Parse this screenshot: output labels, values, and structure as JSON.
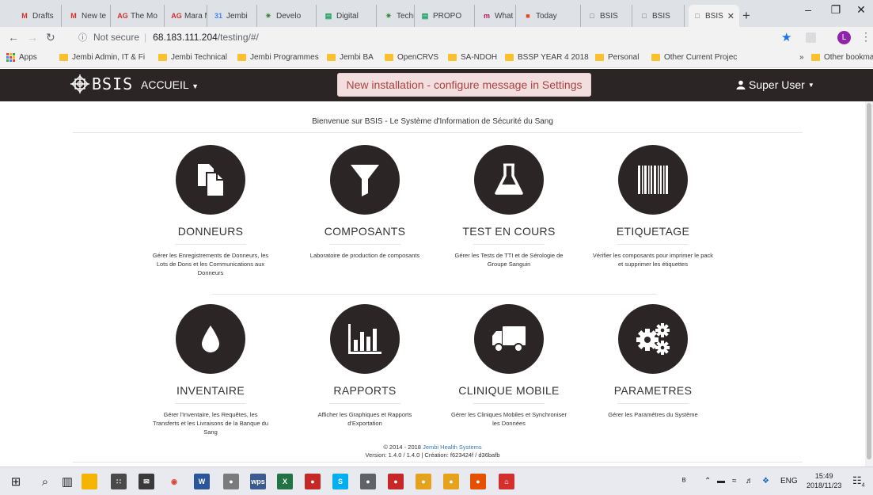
{
  "browser": {
    "tabs": [
      {
        "favicon": "M",
        "favcolor": "#d93025",
        "title": "Drafts",
        "active": false
      },
      {
        "favicon": "M",
        "favcolor": "#d93025",
        "title": "New te",
        "active": false
      },
      {
        "favicon": "AG",
        "favcolor": "#d32f2f",
        "title": "The Mo",
        "active": false
      },
      {
        "favicon": "AG",
        "favcolor": "#d32f2f",
        "title": "Mara M",
        "active": false
      },
      {
        "favicon": "31",
        "favcolor": "#4285f4",
        "title": "Jembi",
        "active": false
      },
      {
        "favicon": "✴",
        "favcolor": "#2e7d32",
        "title": "Develo",
        "active": false
      },
      {
        "favicon": "▤",
        "favcolor": "#0f9d58",
        "title": "Digital",
        "active": false
      },
      {
        "favicon": "✴",
        "favcolor": "#2e7d32",
        "title": "Technic",
        "active": false
      },
      {
        "favicon": "▤",
        "favcolor": "#0f9d58",
        "title": "PROPO",
        "active": false
      },
      {
        "favicon": "m",
        "favcolor": "#c2185b",
        "title": "What is",
        "active": false
      },
      {
        "favicon": "■",
        "favcolor": "#e64a19",
        "title": "Today",
        "active": false
      },
      {
        "favicon": "□",
        "favcolor": "#5f6368",
        "title": "BSIS",
        "active": false
      },
      {
        "favicon": "□",
        "favcolor": "#5f6368",
        "title": "BSIS",
        "active": false
      },
      {
        "favicon": "□",
        "favcolor": "#5f6368",
        "title": "BSIS",
        "active": true
      }
    ],
    "new_tab": "+",
    "window_controls": {
      "minimize": "–",
      "restore": "❐",
      "close": "✕"
    },
    "address": {
      "security_label": "Not secure",
      "host": "68.183.111.204",
      "path": "/testing/#/"
    },
    "profile_initial": "L",
    "bookmarks": [
      {
        "label": "Apps",
        "icon": "apps-grid"
      },
      {
        "label": "Jembi Admin, IT & Fi",
        "icon": "folder"
      },
      {
        "label": "Jembi Technical",
        "icon": "folder"
      },
      {
        "label": "Jembi Programmes",
        "icon": "folder"
      },
      {
        "label": "Jembi BA",
        "icon": "folder"
      },
      {
        "label": "OpenCRVS",
        "icon": "folder"
      },
      {
        "label": "SA-NDOH",
        "icon": "folder"
      },
      {
        "label": "BSSP YEAR 4 2018",
        "icon": "folder"
      },
      {
        "label": "Personal",
        "icon": "folder"
      },
      {
        "label": "Other Current Projec",
        "icon": "folder"
      }
    ],
    "bookmarks_overflow": "»",
    "other_bookmarks": "Other bookmarks"
  },
  "app": {
    "logo_text": "BSIS",
    "nav_menu": "ACCUEIL",
    "banner": "New installation - configure message in Settings",
    "user_menu": "Super User",
    "welcome": "Bienvenue sur BSIS - Le Système d'Information de Sécurité du Sang",
    "tiles": [
      {
        "title": "DONNEURS",
        "icon": "documents-icon",
        "description": "Gérer les Enregistrements de Donneurs, les Lots de Dons et les Communications aux Donneurs"
      },
      {
        "title": "COMPOSANTS",
        "icon": "filter-icon",
        "description": "Laboratoire de production de composants"
      },
      {
        "title": "TEST EN COURS",
        "icon": "flask-icon",
        "description": "Gérer les Tests de TTI et de Sérologie de Groupe Sanguin"
      },
      {
        "title": "ETIQUETAGE",
        "icon": "barcode-icon",
        "description": "Vérifier les composants pour imprimer le pack et supprimer les étiquettes"
      },
      {
        "title": "INVENTAIRE",
        "icon": "blood-drop-icon",
        "description": "Gérer l'Inventaire, les Requêtes, les Transferts et les Livraisons de la Banque du Sang"
      },
      {
        "title": "RAPPORTS",
        "icon": "bar-chart-icon",
        "description": "Afficher les Graphiques et Rapports d'Exportation"
      },
      {
        "title": "CLINIQUE MOBILE",
        "icon": "truck-icon",
        "description": "Gérer les Cliniques Mobiles et Synchroniser les Données"
      },
      {
        "title": "PARAMETRES",
        "icon": "gears-icon",
        "description": "Gérer les Paramètres du Système"
      }
    ],
    "footer": {
      "copyright": "© 2014 - 2018",
      "company": "Jembi Health Systems",
      "version": "Version: 1.4.0 / 1.4.0 | Création: f623424f / d36bafb"
    }
  },
  "taskbar": {
    "apps": [
      "start-icon",
      "search-icon",
      "task-view-icon",
      "file-explorer-icon",
      "calculator-icon",
      "mail-icon",
      "chrome-icon",
      "word-icon",
      "app-icon",
      "wps-icon",
      "excel-icon",
      "app-icon",
      "skype-icon",
      "app-icon",
      "app-icon",
      "app-icon",
      "app-icon",
      "app-icon",
      "acrobat-icon"
    ],
    "language": "ENG",
    "time": "15:49",
    "date": "2018/11/23",
    "notifications": "4"
  }
}
